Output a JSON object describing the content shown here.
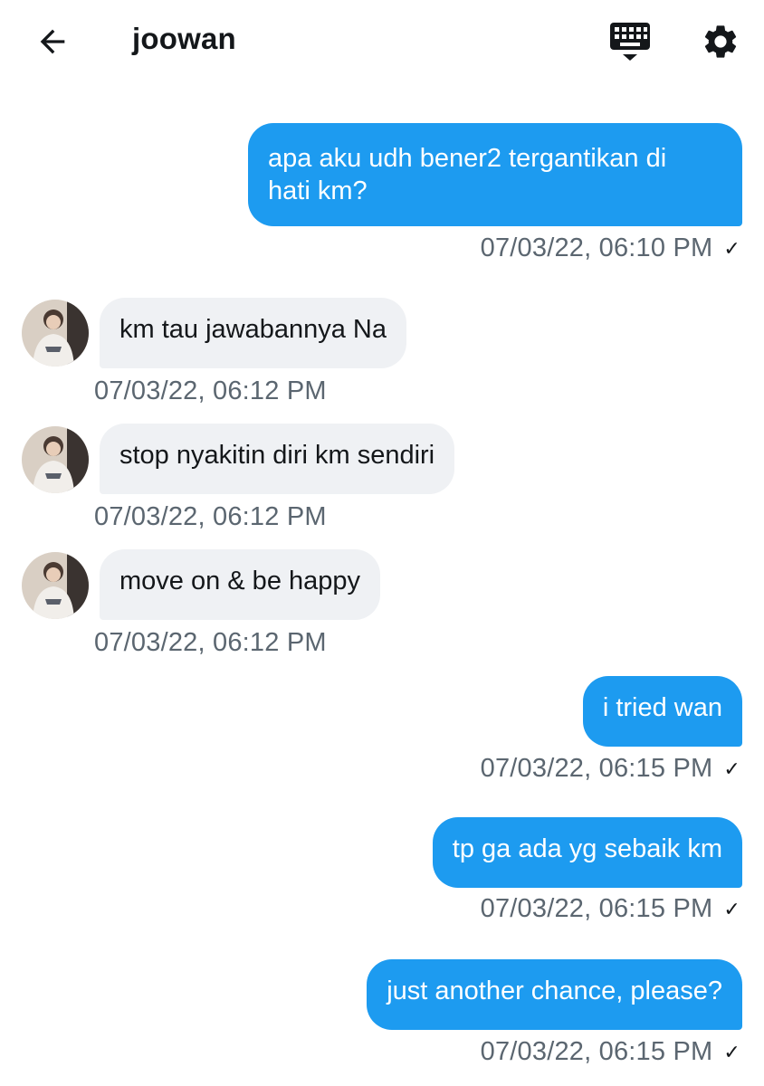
{
  "header": {
    "title": "joowan",
    "back_icon": "arrow-left-icon",
    "keyboard_icon": "keyboard-icon",
    "settings_icon": "gear-icon"
  },
  "colors": {
    "outgoing_bubble": "#1d9bf0",
    "incoming_bubble": "#eff1f4",
    "timestamp": "#5b6670"
  },
  "messages": [
    {
      "direction": "outgoing",
      "lines": [
        "apa aku udh bener2 tergantikan di",
        "hati km?"
      ],
      "time": "07/03/22, 06:10 PM",
      "status": "✓"
    },
    {
      "direction": "incoming",
      "lines": [
        "km tau jawabannya Na"
      ],
      "time": "07/03/22, 06:12 PM"
    },
    {
      "direction": "incoming",
      "lines": [
        "stop nyakitin diri km sendiri"
      ],
      "time": "07/03/22, 06:12 PM"
    },
    {
      "direction": "incoming",
      "lines": [
        "move on & be happy"
      ],
      "time": "07/03/22, 06:12 PM"
    },
    {
      "direction": "outgoing",
      "lines": [
        "i tried wan"
      ],
      "time": "07/03/22, 06:15 PM",
      "status": "✓"
    },
    {
      "direction": "outgoing",
      "lines": [
        "tp ga ada yg sebaik km"
      ],
      "time": "07/03/22, 06:15 PM",
      "status": "✓"
    },
    {
      "direction": "outgoing",
      "lines": [
        "just another chance, please?"
      ],
      "time": "07/03/22, 06:15 PM",
      "status": "✓"
    }
  ]
}
